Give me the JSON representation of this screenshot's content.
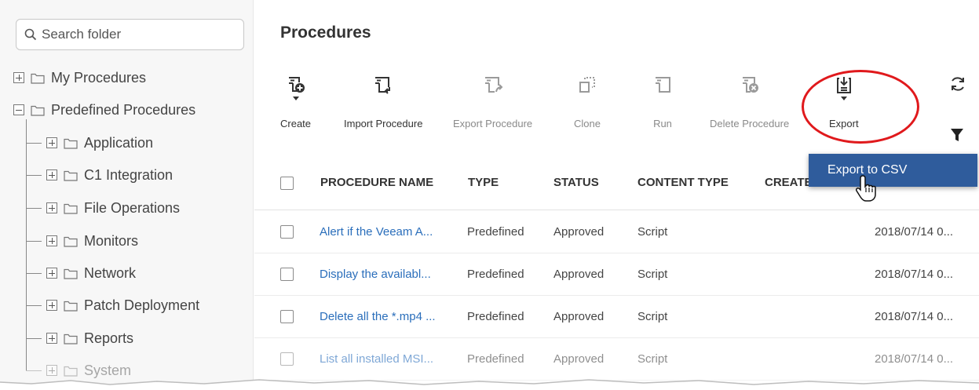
{
  "search": {
    "placeholder": "Search folder"
  },
  "tree": {
    "items": [
      {
        "label": "My Procedures",
        "expanded": false,
        "level": 0
      },
      {
        "label": "Predefined Procedures",
        "expanded": true,
        "level": 0
      },
      {
        "label": "Application",
        "expanded": false,
        "level": 1
      },
      {
        "label": "C1 Integration",
        "expanded": false,
        "level": 1
      },
      {
        "label": "File Operations",
        "expanded": false,
        "level": 1
      },
      {
        "label": "Monitors",
        "expanded": false,
        "level": 1
      },
      {
        "label": "Network",
        "expanded": false,
        "level": 1
      },
      {
        "label": "Patch Deployment",
        "expanded": false,
        "level": 1
      },
      {
        "label": "Reports",
        "expanded": false,
        "level": 1
      },
      {
        "label": "System",
        "expanded": false,
        "level": 1
      }
    ]
  },
  "page": {
    "title": "Procedures"
  },
  "toolbar": {
    "create": "Create",
    "import": "Import Procedure",
    "export_procedure": "Export Procedure",
    "clone": "Clone",
    "run": "Run",
    "delete": "Delete Procedure",
    "export": "Export"
  },
  "dropdown": {
    "export_csv": "Export to CSV"
  },
  "table": {
    "headers": {
      "name": "PROCEDURE NAME",
      "type": "TYPE",
      "status": "STATUS",
      "content_type": "CONTENT TYPE",
      "created": "CREATE"
    },
    "rows": [
      {
        "name": "Alert if the Veeam A...",
        "type": "Predefined",
        "status": "Approved",
        "content_type": "Script",
        "date": "2018/07/14 0..."
      },
      {
        "name": "Display the availabl...",
        "type": "Predefined",
        "status": "Approved",
        "content_type": "Script",
        "date": "2018/07/14 0..."
      },
      {
        "name": "Delete all the *.mp4 ...",
        "type": "Predefined",
        "status": "Approved",
        "content_type": "Script",
        "date": "2018/07/14 0..."
      },
      {
        "name": "List all installed MSI...",
        "type": "Predefined",
        "status": "Approved",
        "content_type": "Script",
        "date": "2018/07/14 0..."
      }
    ]
  },
  "colors": {
    "link": "#2a6ebb",
    "dropdown_bg": "#2f5c9c",
    "highlight_circle": "#e0191c"
  }
}
